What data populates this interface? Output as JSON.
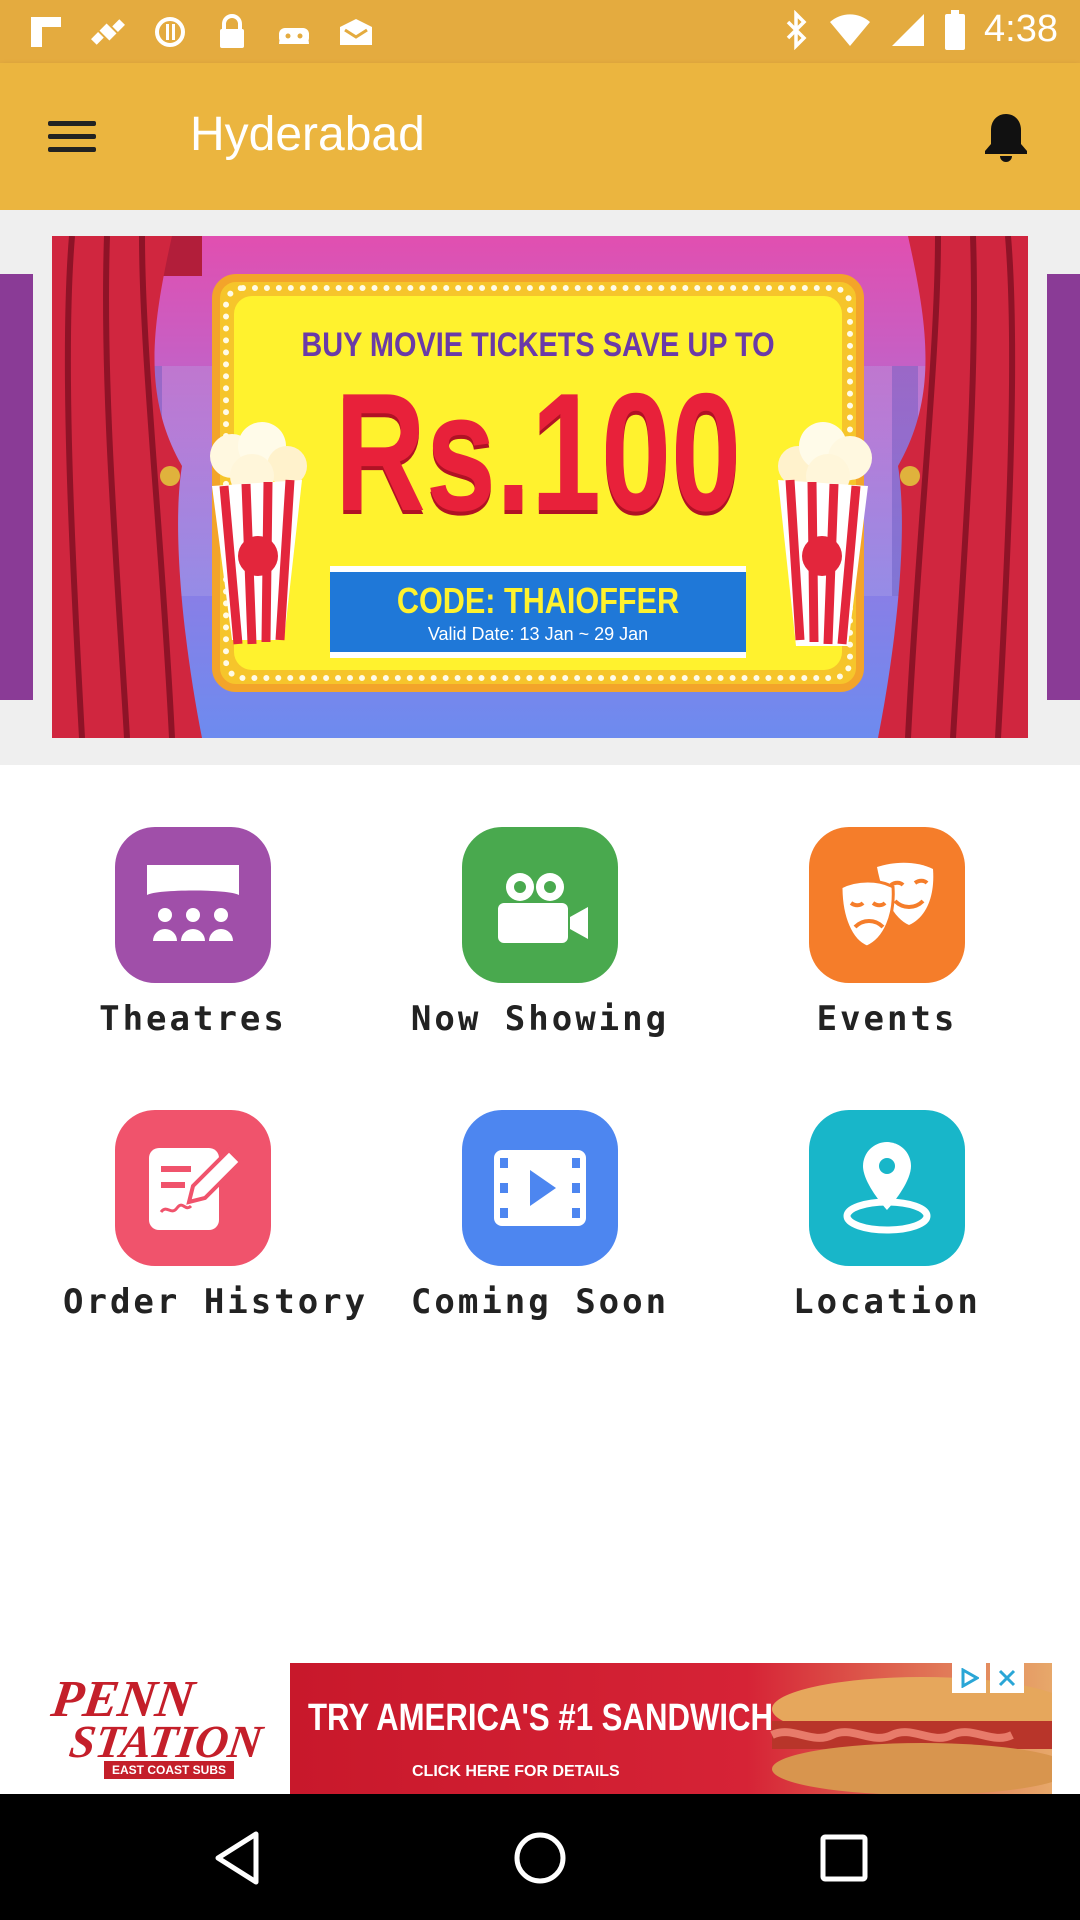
{
  "status_bar": {
    "time": "4:38",
    "icons": [
      "flipboard-icon",
      "fake-gps-icon",
      "data-saver-icon",
      "lock-icon",
      "android-icon",
      "mail-icon",
      "bluetooth-icon",
      "wifi-icon",
      "signal-icon",
      "battery-icon"
    ]
  },
  "app_bar": {
    "title": "Hyderabad",
    "menu_icon": "menu-icon",
    "bell_icon": "notification-bell-icon",
    "color": "#ebb53f"
  },
  "banner": {
    "headline": "BUY MOVIE TICKETS SAVE UP TO",
    "amount": "Rs.100",
    "code": "CODE: THAIOFFER",
    "valid": "Valid Date: 13 Jan ~ 29 Jan"
  },
  "tiles": [
    {
      "label": "Theatres",
      "icon": "theatre-seats-icon",
      "color": "#a04fa9"
    },
    {
      "label": "Now Showing",
      "icon": "video-camera-icon",
      "color": "#49a94e"
    },
    {
      "label": "Events",
      "icon": "drama-masks-icon",
      "color": "#f57d2a"
    },
    {
      "label": "Order History",
      "icon": "order-edit-icon",
      "color": "#f0536c"
    },
    {
      "label": "Coming Soon",
      "icon": "film-play-icon",
      "color": "#4d86f0"
    },
    {
      "label": "Location",
      "icon": "location-pin-icon",
      "color": "#18b6c9"
    }
  ],
  "ad": {
    "brand_line1": "PENN",
    "brand_line2": "STATION",
    "brand_sub": "EAST COAST SUBS",
    "headline": "TRY AMERICA'S #1 SANDWICH",
    "cta": "CLICK HERE FOR DETAILS"
  },
  "nav_bar": {
    "buttons": [
      "back-icon",
      "home-icon",
      "recents-icon"
    ]
  }
}
